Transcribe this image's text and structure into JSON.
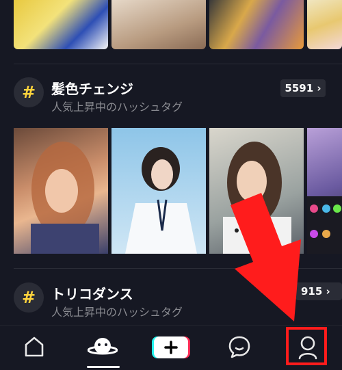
{
  "sections": [
    {
      "title": "髪色チェンジ",
      "subtitle": "人気上昇中のハッシュタグ",
      "count": "5591",
      "hash_symbol": "#"
    },
    {
      "title": "トリコダンス",
      "subtitle": "人気上昇中のハッシュタグ",
      "count": "915",
      "hash_symbol": "#"
    }
  ],
  "tabbar": [
    {
      "icon": "home-icon"
    },
    {
      "icon": "discover-icon",
      "active": true
    },
    {
      "icon": "create-plus-icon",
      "label": "+"
    },
    {
      "icon": "inbox-icon"
    },
    {
      "icon": "profile-icon",
      "highlighted": true
    }
  ],
  "colors": {
    "background": "#161823",
    "accent_yellow": "#ffd33d",
    "highlight_red": "#ff1c1c"
  }
}
